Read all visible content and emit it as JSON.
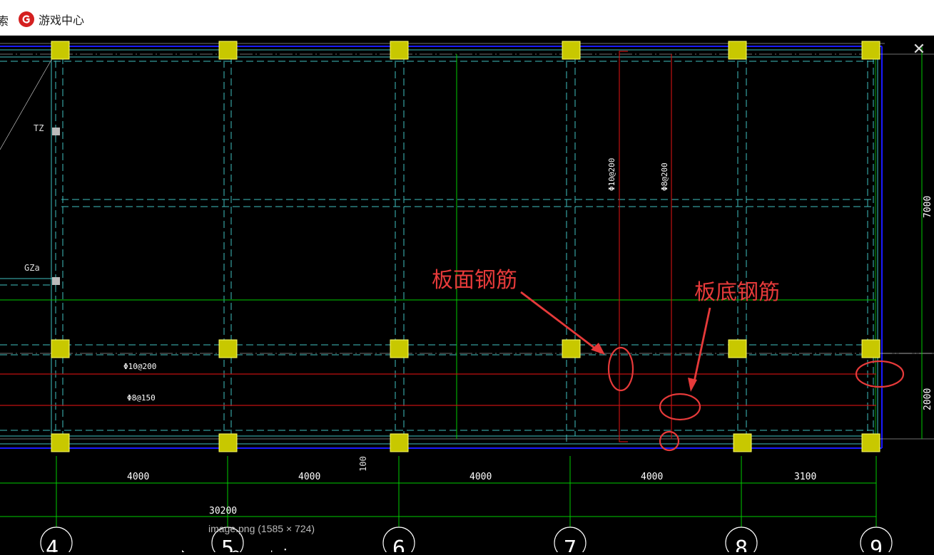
{
  "browser": {
    "partial_search_label": "索",
    "bookmark_label": "游戏中心"
  },
  "viewer": {
    "caption": "image.png (1585 × 724)",
    "close_symbol": "✕"
  },
  "drawing": {
    "labels": {
      "tz": "TZ",
      "gza": "GZa",
      "rebar_top_vert": "Φ10@200",
      "rebar_bot_vert": "Φ8@200",
      "rebar_top_horiz": "Φ10@200",
      "rebar_bot_horiz": "Φ8@150",
      "dim_100": "100"
    },
    "annotations": {
      "top_rebar": "板面钢筋",
      "bottom_rebar": "板底钢筋"
    },
    "dimensions": {
      "spans": [
        "4000",
        "4000",
        "4000",
        "4000",
        "3100"
      ],
      "total": "30200",
      "right_upper": "7000",
      "right_lower": "2000"
    },
    "axes": [
      "4",
      "5",
      "6",
      "7",
      "8",
      "9"
    ],
    "colors": {
      "background": "#000000",
      "column_fill": "#c8c800",
      "beam_cyan": "#3fbfbf",
      "grid_green": "#00cc00",
      "rebar_red": "#c01010",
      "border_blue": "#1a1aff",
      "annotation_red": "#e63a3a"
    }
  }
}
